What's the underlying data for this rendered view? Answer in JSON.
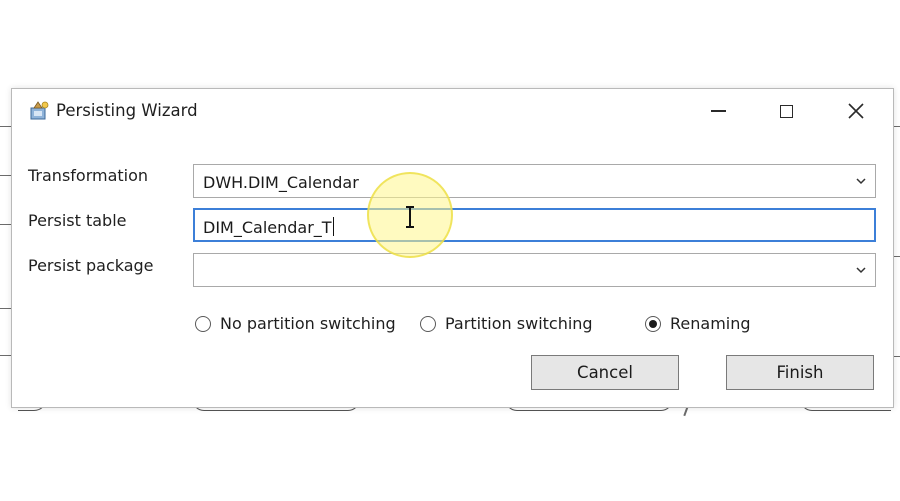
{
  "dialog": {
    "title": "Persisting Wizard",
    "icons": {
      "app": "wizard-app-icon",
      "minimize": "minimize-icon",
      "maximize": "maximize-icon",
      "close": "close-icon"
    }
  },
  "form": {
    "transformation": {
      "label": "Transformation",
      "value": "DWH.DIM_Calendar"
    },
    "persist_table": {
      "label": "Persist table",
      "value": "DIM_Calendar_T"
    },
    "persist_package": {
      "label": "Persist package",
      "value": ""
    }
  },
  "options": [
    {
      "label": "No partition switching",
      "selected": false
    },
    {
      "label": "Partition switching",
      "selected": false
    },
    {
      "label": "Renaming",
      "selected": true
    }
  ],
  "buttons": {
    "cancel": "Cancel",
    "finish": "Finish"
  },
  "colors": {
    "focus_border": "#3c7fd8",
    "button_bg": "#e6e6e6",
    "cursor_highlight": "#fff58c"
  }
}
